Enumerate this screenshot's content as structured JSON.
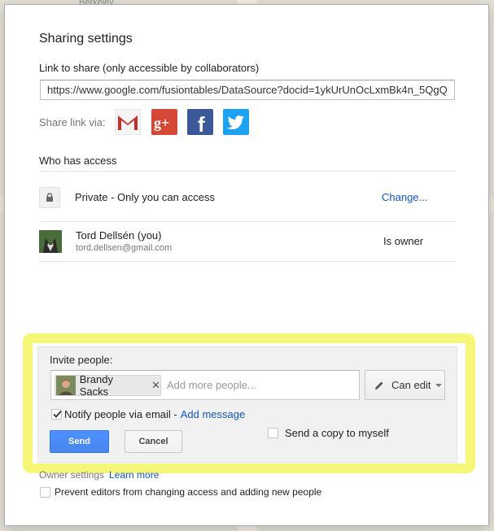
{
  "background": {
    "map_label": "Berkeley"
  },
  "dialog": {
    "title": "Sharing settings",
    "link": {
      "label": "Link to share (only accessible by collaborators)",
      "value": "https://www.google.com/fusiontables/DataSource?docid=1ykUrUnOcLxmBk4n_5QgQ"
    },
    "share_via": {
      "label": "Share link via:",
      "services": [
        {
          "name": "Gmail",
          "icon": "gmail-icon",
          "color": "#c4302b"
        },
        {
          "name": "Google+",
          "icon": "google-plus-icon",
          "color": "#d34836"
        },
        {
          "name": "Facebook",
          "icon": "facebook-icon",
          "color": "#3b5998"
        },
        {
          "name": "Twitter",
          "icon": "twitter-icon",
          "color": "#1da1f2"
        }
      ]
    },
    "access": {
      "heading": "Who has access",
      "visibility": {
        "icon": "lock-icon",
        "text": "Private - Only you can access",
        "change_link": "Change..."
      },
      "owner": {
        "name": "Tord Dellsén (you)",
        "email": "tord.dellsen@gmail.com",
        "role": "Is owner"
      }
    },
    "invite": {
      "label": "Invite people:",
      "chips": [
        {
          "name": "Brandy Sacks"
        }
      ],
      "placeholder": "Add more people...",
      "permission": {
        "value": "Can edit",
        "icon": "pencil-icon"
      },
      "notify": {
        "checked": true,
        "text": "Notify people via email -",
        "add_message": "Add message"
      },
      "send_copy": {
        "checked": false,
        "text": "Send a copy to myself"
      },
      "send_label": "Send",
      "cancel_label": "Cancel"
    },
    "owner_settings": {
      "label": "Owner settings",
      "learn_more": "Learn more",
      "prevent": {
        "checked": false,
        "text": "Prevent editors from changing access and adding new people"
      }
    }
  },
  "colors": {
    "link": "#1155cc",
    "primary_button": "#4d90fe",
    "highlight": "#f5f460"
  }
}
